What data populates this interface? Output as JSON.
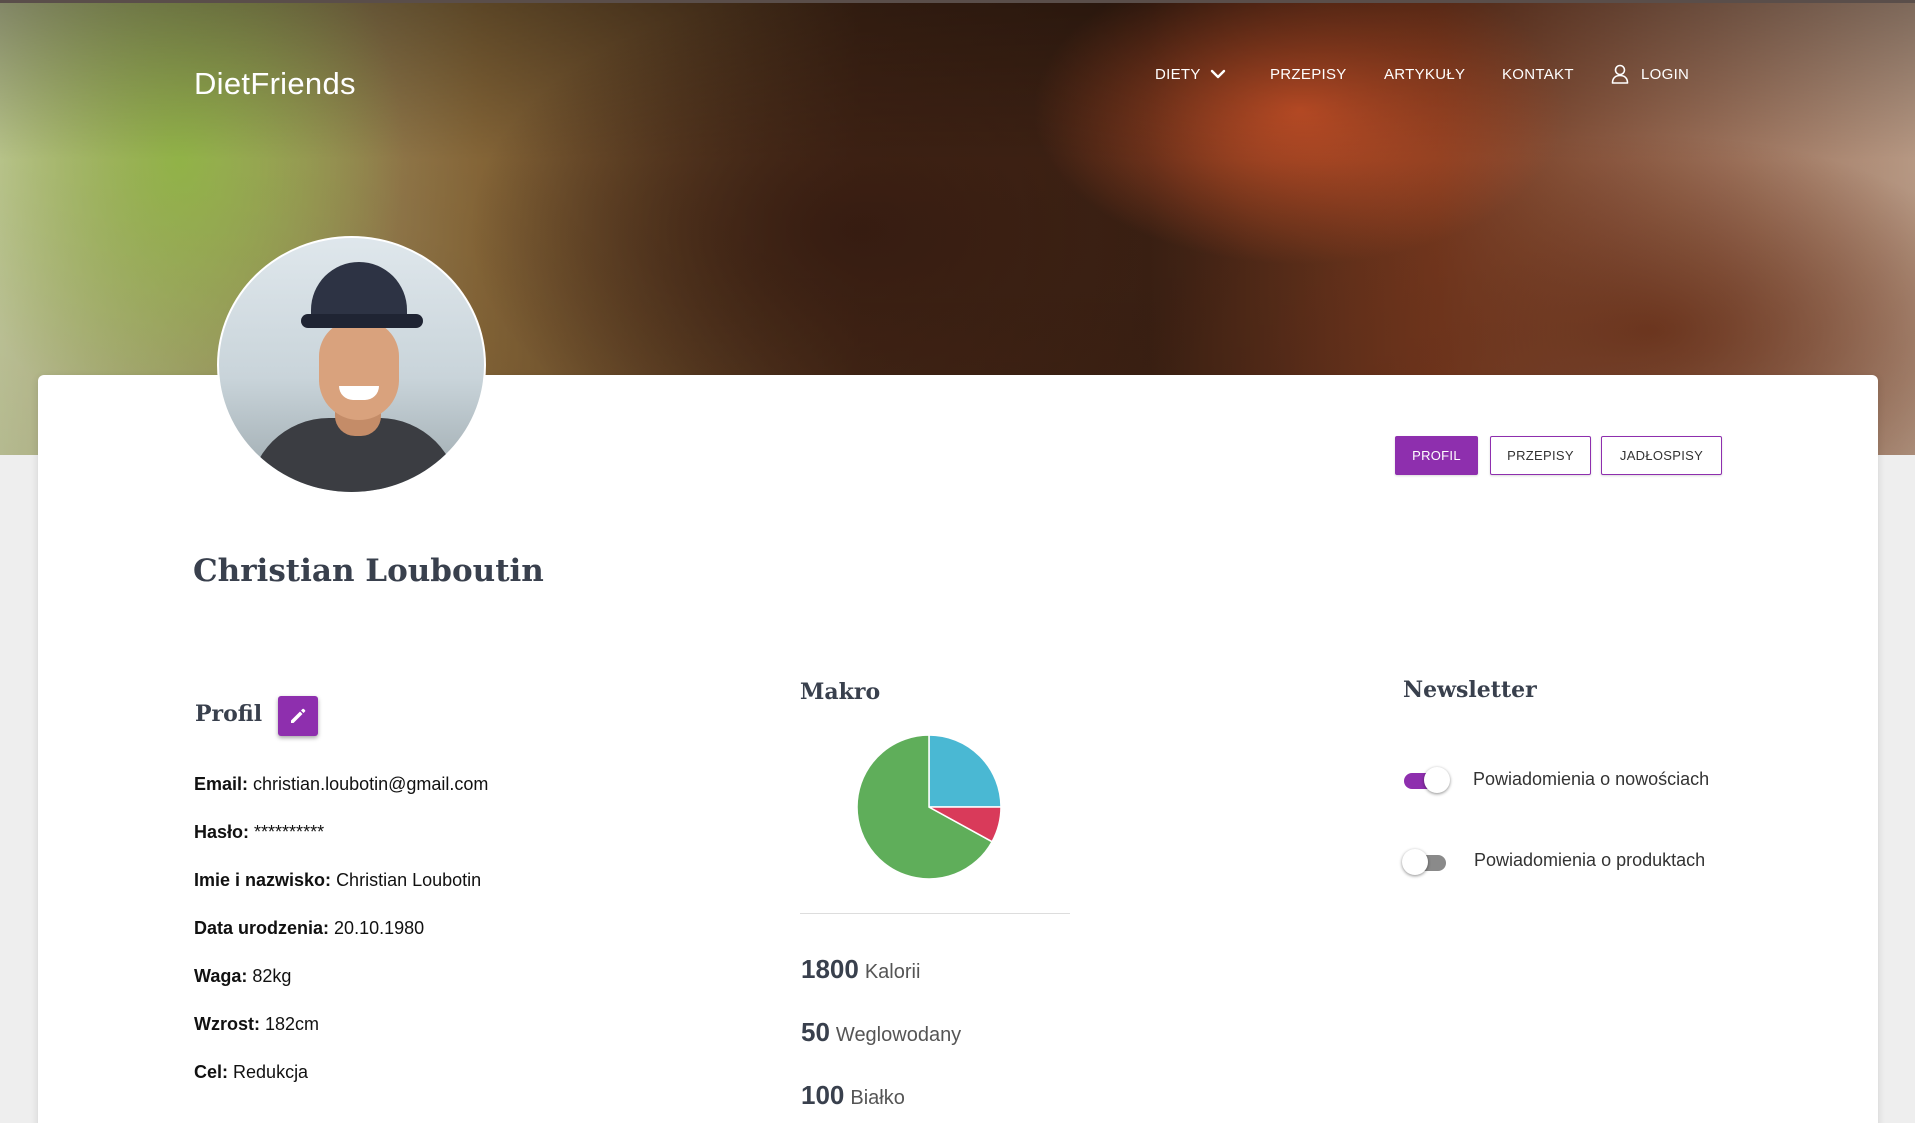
{
  "header": {
    "brand": "DietFriends",
    "nav": {
      "diety": "DIETY",
      "przepisy": "PRZEPISY",
      "artykuly": "ARTYKUŁY",
      "kontakt": "KONTAKT",
      "login": "LOGIN"
    }
  },
  "tabs": {
    "profil": "PROFIL",
    "przepisy": "PRZEPISY",
    "jadlospisy": "JADŁOSPISY",
    "active": "PROFIL"
  },
  "user": {
    "name": "Christian Louboutin"
  },
  "profile": {
    "title": "Profil",
    "rows": [
      {
        "label": "Email:",
        "value": "christian.loubotin@gmail.com"
      },
      {
        "label": "Hasło:",
        "value": "**********"
      },
      {
        "label": "Imie i nazwisko:",
        "value": "Christian Loubotin"
      },
      {
        "label": "Data urodzenia:",
        "value": "20.10.1980"
      },
      {
        "label": "Waga:",
        "value": "82kg"
      },
      {
        "label": "Wzrost:",
        "value": "182cm"
      },
      {
        "label": "Cel:",
        "value": "Redukcja"
      }
    ]
  },
  "makro": {
    "title": "Makro",
    "stats": [
      {
        "value": "1800",
        "unit": "Kalorii"
      },
      {
        "value": "50",
        "unit": "Weglowodany"
      },
      {
        "value": "100",
        "unit": "Białko"
      }
    ]
  },
  "chart_data": {
    "type": "pie",
    "title": "",
    "slices": [
      {
        "value": 0.25,
        "color": "#4ab8d3"
      },
      {
        "value": 0.67,
        "color": "#5fae5a"
      },
      {
        "value": 0.08,
        "color": "#d93a5a"
      }
    ]
  },
  "newsletter": {
    "title": "Newsletter",
    "options": [
      {
        "label": "Powiadomienia o nowościach",
        "enabled": true
      },
      {
        "label": "Powiadomienia o produktach",
        "enabled": false
      }
    ]
  },
  "colors": {
    "accent": "#8e2fae",
    "heading": "#39404d"
  }
}
